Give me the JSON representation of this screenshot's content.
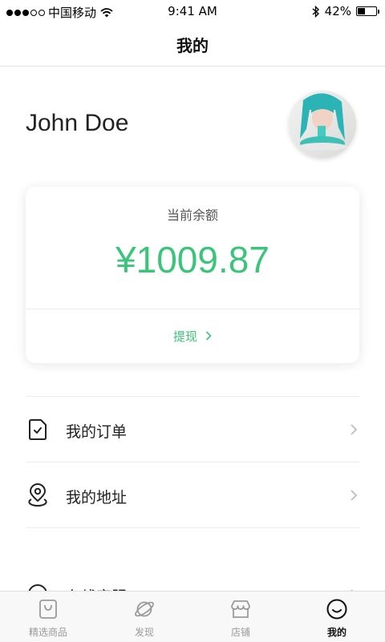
{
  "status_bar": {
    "carrier": "中国移动",
    "time": "9:41 AM",
    "battery_text": "42%",
    "battery_level": 0.42
  },
  "nav": {
    "title": "我的"
  },
  "profile": {
    "name": "John Doe"
  },
  "balance": {
    "label": "当前余额",
    "amount": "¥1009.87",
    "withdraw_label": "提现"
  },
  "menu": {
    "items": [
      {
        "label": "我的订单",
        "icon": "order-document-icon"
      },
      {
        "label": "我的地址",
        "icon": "location-pin-icon"
      },
      {
        "label": "在线客服",
        "icon": "customer-service-icon"
      }
    ]
  },
  "tab_bar": {
    "items": [
      {
        "label": "精选商品",
        "icon": "shopping-bag-icon",
        "active": false
      },
      {
        "label": "发现",
        "icon": "planet-icon",
        "active": false
      },
      {
        "label": "店铺",
        "icon": "storefront-icon",
        "active": false
      },
      {
        "label": "我的",
        "icon": "smiley-face-icon",
        "active": true
      }
    ]
  },
  "colors": {
    "accent": "#3cc47a",
    "tab_inactive": "#999999",
    "tab_active": "#111111"
  }
}
